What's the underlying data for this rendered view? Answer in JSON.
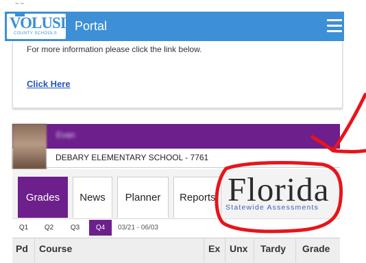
{
  "header": {
    "logo_text": "VOLUSIA",
    "logo_sub": "COUNTY SCHOOLS",
    "title": "Portal"
  },
  "info": {
    "text": "For more information please click the link below.",
    "link": "Click Here"
  },
  "student": {
    "name": "Evan",
    "school": "DEBARY ELEMENTARY SCHOOL - 7761"
  },
  "tabs": [
    {
      "label": "Grades",
      "active": true
    },
    {
      "label": "News",
      "active": false
    },
    {
      "label": "Planner",
      "active": false
    },
    {
      "label": "Reports",
      "active": false
    }
  ],
  "quarters": [
    {
      "label": "Q1",
      "active": false
    },
    {
      "label": "Q2",
      "active": false
    },
    {
      "label": "Q3",
      "active": false
    },
    {
      "label": "Q4",
      "active": true
    }
  ],
  "quarter_range": "03/21 - 06/03",
  "table_headers": [
    "Pd",
    "Course",
    "Ex",
    "Unx",
    "Tardy",
    "Grade"
  ],
  "overlay": {
    "florida_word": "Florida",
    "florida_sub": "Statewide Assessments"
  },
  "colors": {
    "header_blue": "#3d8fd6",
    "student_purple": "#6d1f8c",
    "annotation_red": "#e8141b"
  }
}
